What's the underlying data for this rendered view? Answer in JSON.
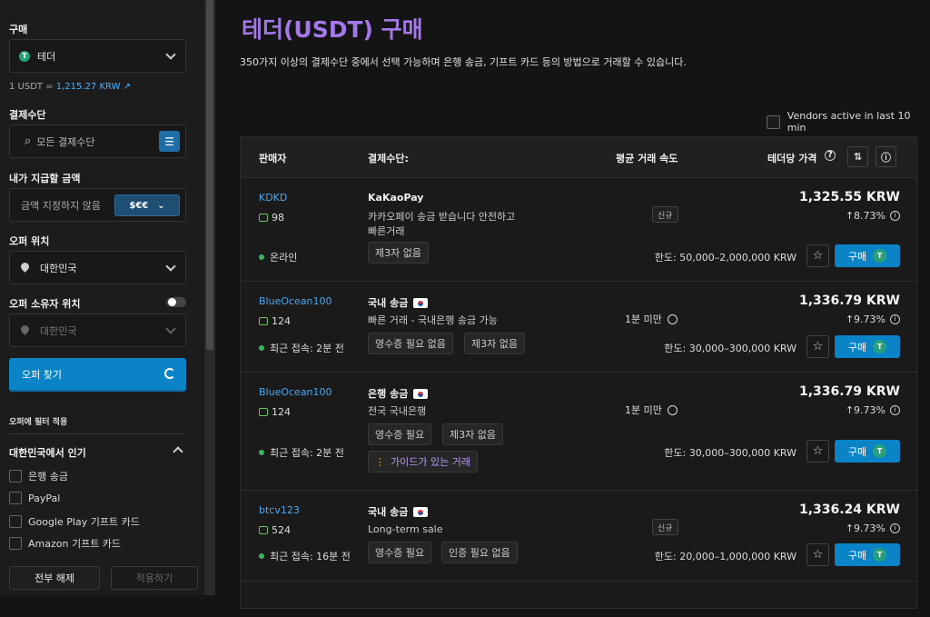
{
  "sidebar": {
    "buy_label": "구매",
    "coin_select": "테더",
    "rate_prefix": "1 USDT = ",
    "rate_value": "1,215.27 KRW",
    "payment_label": "결제수단",
    "payment_placeholder": "모든 결제수단",
    "amount_label": "내가 지급할 금액",
    "amount_placeholder": "금액 지정하지 않음",
    "currency": "$€€",
    "location_label": "오퍼 위치",
    "location_value": "대한민국",
    "owner_location_label": "오퍼 소유자 위치",
    "owner_location_value": "대한민국",
    "find_button": "오퍼 찾기",
    "filter_label": "오퍼에 필터 적용",
    "popular_label": "대한민국에서 인기",
    "popular_items": [
      "은행 송금",
      "PayPal",
      "Google Play 기프트 카드",
      "Amazon 기프트 카드"
    ],
    "clear_button": "전부 해제",
    "apply_button": "적용하기"
  },
  "main": {
    "title": "테더(USDT) 구매",
    "description": "350가지 이상의 결제수단 중에서 선택 가능하며 은행 송금, 기프트 카드 등의 방법으로 거래할 수 있습니다.",
    "vendors_active": "Vendors active in last 10 min",
    "headers": {
      "seller": "판매자",
      "method": "결제수단:",
      "speed": "평균 거래 속도",
      "price": "테더당 가격"
    },
    "buy_label": "구매",
    "rows": [
      {
        "seller": "KDKD",
        "likes": "98",
        "status": "온라인",
        "method": "KaKaoPay",
        "desc": "카카오페이 송금 받습니다 안전하고 빠른거래",
        "tags": [
          "제3자 없음"
        ],
        "badge": "신규",
        "price": "1,325.55 KRW",
        "pct": "8.73%",
        "limit": "한도: 50,000–2,000,000 KRW"
      },
      {
        "seller": "BlueOcean100",
        "likes": "124",
        "status": "최근 접속: 2분 전",
        "method": "국내 송금",
        "desc": "빠른 거래 - 국내은행 송금 가능",
        "tags": [
          "영수증 필요 없음",
          "제3자 없음"
        ],
        "speed": "1분 미만",
        "price": "1,336.79 KRW",
        "pct": "9.73%",
        "limit": "한도: 30,000–300,000 KRW"
      },
      {
        "seller": "BlueOcean100",
        "likes": "124",
        "status": "최근 접속: 2분 전",
        "method": "은행 송금",
        "desc": "전국 국내은행",
        "tags": [
          "영수증 필요",
          "제3자 없음"
        ],
        "guide": "가이드가 있는 거래",
        "speed": "1분 미만",
        "price": "1,336.79 KRW",
        "pct": "9.73%",
        "limit": "한도: 30,000–300,000 KRW"
      },
      {
        "seller": "btcv123",
        "likes": "524",
        "status": "최근 접속: 16분 전",
        "method": "국내 송금",
        "desc": "Long-term sale",
        "tags": [
          "영수증 필요",
          "인증 필요 없음"
        ],
        "badge": "신규",
        "price": "1,336.24 KRW",
        "pct": "9.73%",
        "limit": "한도: 20,000–1,000,000 KRW"
      }
    ]
  }
}
